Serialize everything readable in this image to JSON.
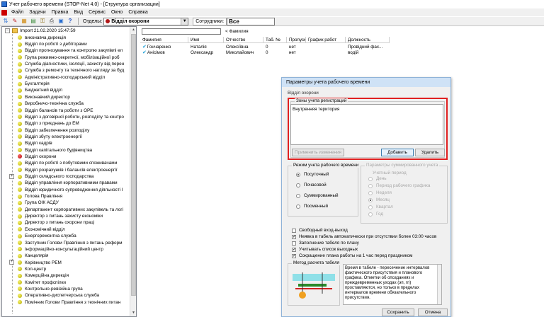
{
  "window": {
    "title": "Учет рабочего времени (STOP-Net 4.0) - [Структура организации]"
  },
  "menu": [
    "Файл",
    "Задачи",
    "Правка",
    "Вид",
    "Сервис",
    "Окно",
    "Справка"
  ],
  "toolbar": {
    "dept_label": "Отделы:",
    "dept_value": "Відділ охорони",
    "employees_label": "Сотрудники:",
    "employees_value": "Все"
  },
  "tree": {
    "root": "Import 21.02.2020 15:47:59",
    "items": [
      "виконавча дирекція",
      "Відділ по роботі з дебіторами",
      "Відділ прогнозування та контролю закупівлі ел",
      "Група режимно-секретної, мобілізаційної роб",
      "Служба діагностики, ізоляції, захисту від перен",
      "Служба з ремонту та технічного нагляду за буд",
      "Адміністративно-господарський відділ",
      "Бухгалтерія",
      "Бюджетний відділ",
      "Виконавчий директор",
      "Виробничо-технічна служба",
      "Відділ балансів та роботи з ОРЕ",
      "Відділ з договірної роботи, розподілу та контро",
      "Відділ з приєднань до ЕМ",
      "Відділ забезпечення розподілу",
      "Відділ збуту електроенергії",
      "Відділ кадрів",
      "Відділ капітального будівництва",
      "Відділ охорони",
      "Відділ по роботі з побутовими споживачами",
      "Відділ розрахунків і балансів електроенергії",
      "Відділ складського господарства",
      "Відділ управління корпоративними правами",
      "Відділ юридичного супроводження діяльності І",
      "Голова Правління",
      "Група ОІК АСДУ",
      "Департамент корпоративних закупівель та логі",
      "Директор з питань захисту економіки",
      "Директор з питань охорони праці",
      "Економічний відділ",
      "Енергоремонтна служба",
      "Заступник Голови Правління з питань реформ",
      "Інформаційно-консультаційний центр",
      "Канцелярія",
      "Керівництво РЕМ",
      "Кол-центр",
      "Комерційна дирекція",
      "Комітет профспілки",
      "Контрольно-ревізійна група",
      "Оперативно-диспетчерська служба",
      "Помічник Голови Правління з технічних питан"
    ]
  },
  "employees": {
    "filter_label": "< Фамилия",
    "columns": [
      "Фамилия",
      "Имя",
      "Отчество",
      "Таб. №",
      "Пропуск",
      "График работ",
      "Должность"
    ],
    "rows": [
      {
        "last": "Гончаренко",
        "first": "Наталія",
        "middle": "Олексіївна",
        "tab": "0",
        "pass": "нет",
        "schedule": "",
        "position": "Провідний фах..."
      },
      {
        "last": "Анісімов",
        "first": "Олександр",
        "middle": "Миколайович",
        "tab": "0",
        "pass": "нет",
        "schedule": "",
        "position": "водій"
      }
    ]
  },
  "dialog": {
    "title": "Параметры учета рабочего времени",
    "department": "Відділ охорони",
    "zones_group": "Зоны учета регистраций",
    "zones": [
      "Внутренняя територия"
    ],
    "apply_button": "Применить изменения",
    "add_button": "Добавить",
    "delete_button": "Удалить",
    "mode_group": "Режим учета рабочего времени",
    "modes": [
      {
        "label": "Посуточный",
        "selected": true
      },
      {
        "label": "Почасовой",
        "selected": false
      },
      {
        "label": "Суммированный",
        "selected": false
      },
      {
        "label": "Посменный",
        "selected": false
      }
    ],
    "summary_group": "Параметры суммированного учета",
    "period_label": "Учетный период",
    "periods": [
      {
        "label": "День",
        "selected": false
      },
      {
        "label": "Период рабочего графика",
        "selected": false
      },
      {
        "label": "Неделя",
        "selected": false
      },
      {
        "label": "Месяц",
        "selected": true
      },
      {
        "label": "Квартал",
        "selected": false
      },
      {
        "label": "Год",
        "selected": false
      }
    ],
    "options": [
      {
        "label": "Свободный вход-выход",
        "checked": false
      },
      {
        "label": "Неявка в табель автоматически при отсутствии более 03:00 часов",
        "checked": true
      },
      {
        "label": "Заполнение табеля по плану",
        "checked": false
      },
      {
        "label": "Учитывать список выходных",
        "checked": true
      },
      {
        "label": "Сокращение плана работы на 1 час перед праздником",
        "checked": true
      }
    ],
    "method_group": "Метод расчета табеля",
    "method_text": "Время в табеле - пересечение интервалов фактического присутствия и планового графика. Отметки об опозданиях и преждевременных уходах (эп, гп) проставляются, но только в пределах интервалов времени обязательного присутствия.",
    "save_button": "Сохранить",
    "cancel_button": "Отмена"
  }
}
